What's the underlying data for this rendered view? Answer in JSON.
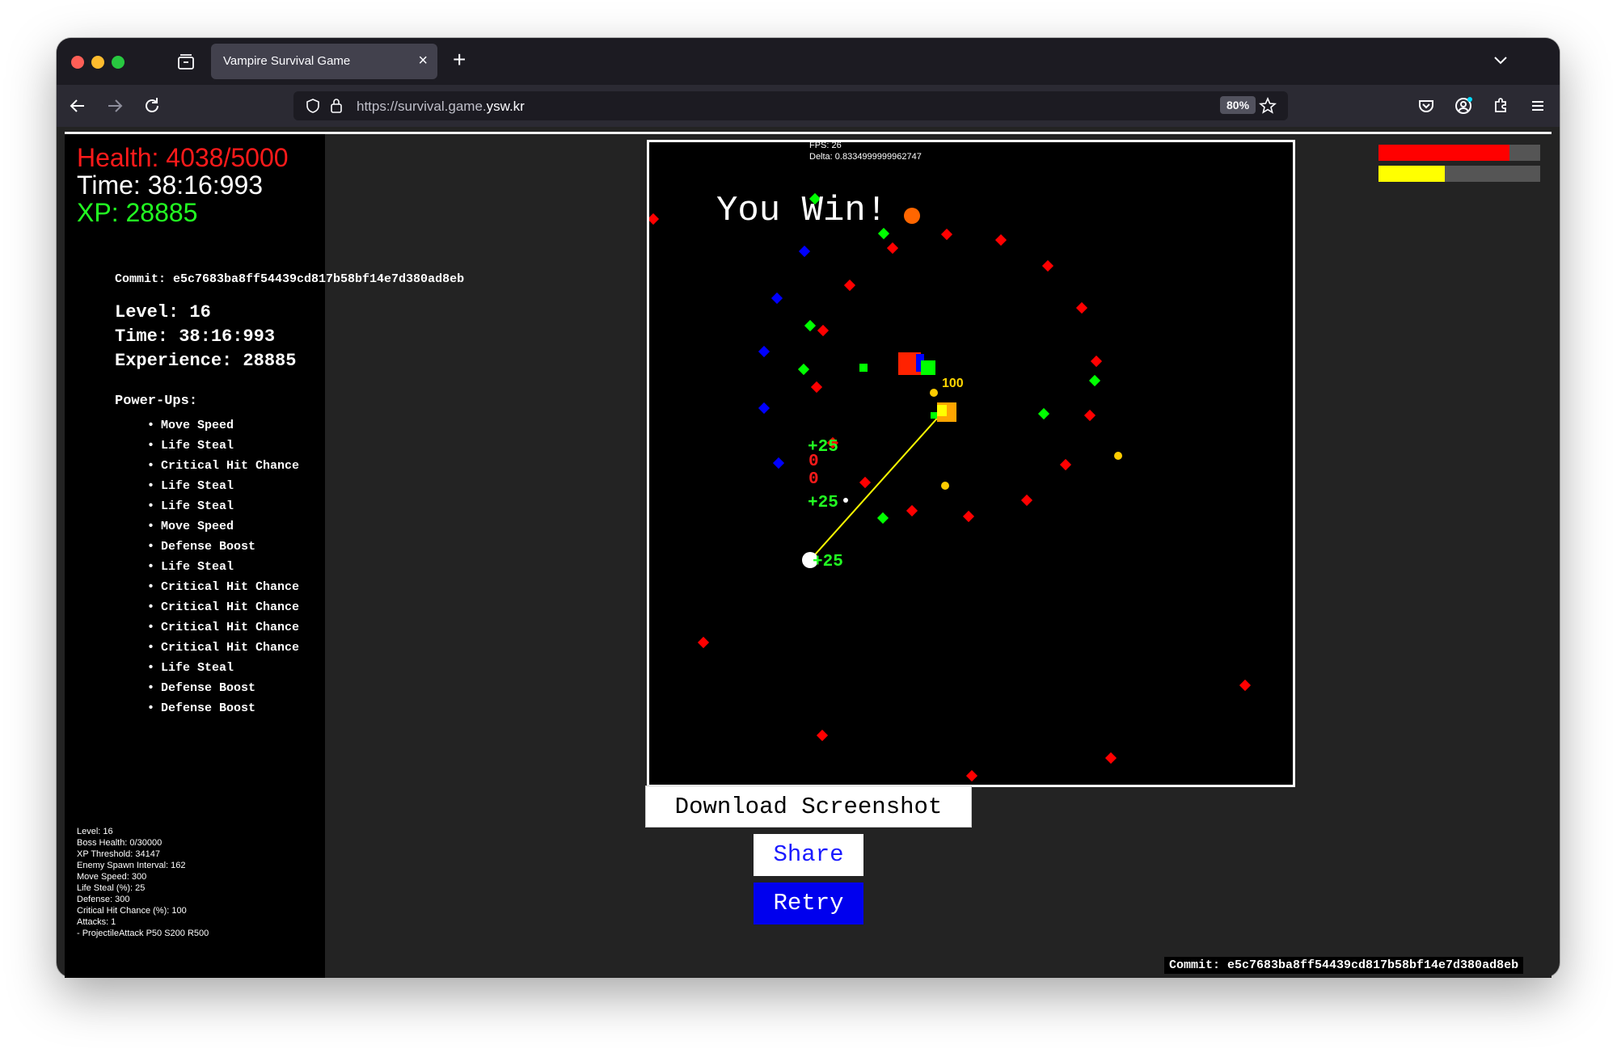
{
  "browser": {
    "tab_title": "Vampire Survival Game",
    "url_prefix": "https://survival.game.",
    "url_domain": "ysw.kr",
    "zoom": "80%"
  },
  "hud": {
    "health": "Health: 4038/5000",
    "time": "Time: 38:16:993",
    "xp": "XP: 28885"
  },
  "summary": {
    "commit": "Commit: e5c7683ba8ff54439cd817b58bf14e7d380ad8eb",
    "level": "Level: 16",
    "time": "Time: 38:16:993",
    "experience": "Experience: 28885",
    "powerups_heading": "Power-Ups:",
    "powerups": [
      "Move Speed",
      "Life Steal",
      "Critical Hit Chance",
      "Life Steal",
      "Life Steal",
      "Move Speed",
      "Defense Boost",
      "Life Steal",
      "Critical Hit Chance",
      "Critical Hit Chance",
      "Critical Hit Chance",
      "Critical Hit Chance",
      "Life Steal",
      "Defense Boost",
      "Defense Boost"
    ]
  },
  "debug": [
    "Level: 16",
    "Boss Health: 0/30000",
    "XP Threshold: 34147",
    "Enemy Spawn Interval: 162",
    "Move Speed: 300",
    "Life Steal (%): 25",
    "Defense: 300",
    "Critical Hit Chance (%): 100",
    "Attacks: 1",
    " - ProjectileAttack P50 S200 R500"
  ],
  "game": {
    "fps": "FPS: 26",
    "delta": "Delta: 0.8334999999962747",
    "win_text": "You Win!",
    "damage_labels": [
      {
        "text": "100",
        "color": "#ffd700"
      },
      {
        "text": "+25",
        "color": "#22ff22"
      },
      {
        "text": "0",
        "color": "#ff1a1a"
      },
      {
        "text": "0",
        "color": "#ff1a1a"
      },
      {
        "text": "+25",
        "color": "#22ff22"
      },
      {
        "text": "+25",
        "color": "#22ff22"
      }
    ],
    "colors": {
      "enemy_red": "#ff0000",
      "enemy_blue": "#0000ff",
      "enemy_green": "#00ff00",
      "xp_orb": "#ffcc00",
      "boss": "#ff6600"
    }
  },
  "bars": {
    "health_fraction": 0.81,
    "xp_fraction": 0.41,
    "health_color": "#ff0000",
    "xp_color": "#ffff00"
  },
  "buttons": {
    "download": "Download Screenshot",
    "share": "Share",
    "retry": "Retry"
  },
  "footer": {
    "commit": "Commit: e5c7683ba8ff54439cd817b58bf14e7d380ad8eb"
  }
}
